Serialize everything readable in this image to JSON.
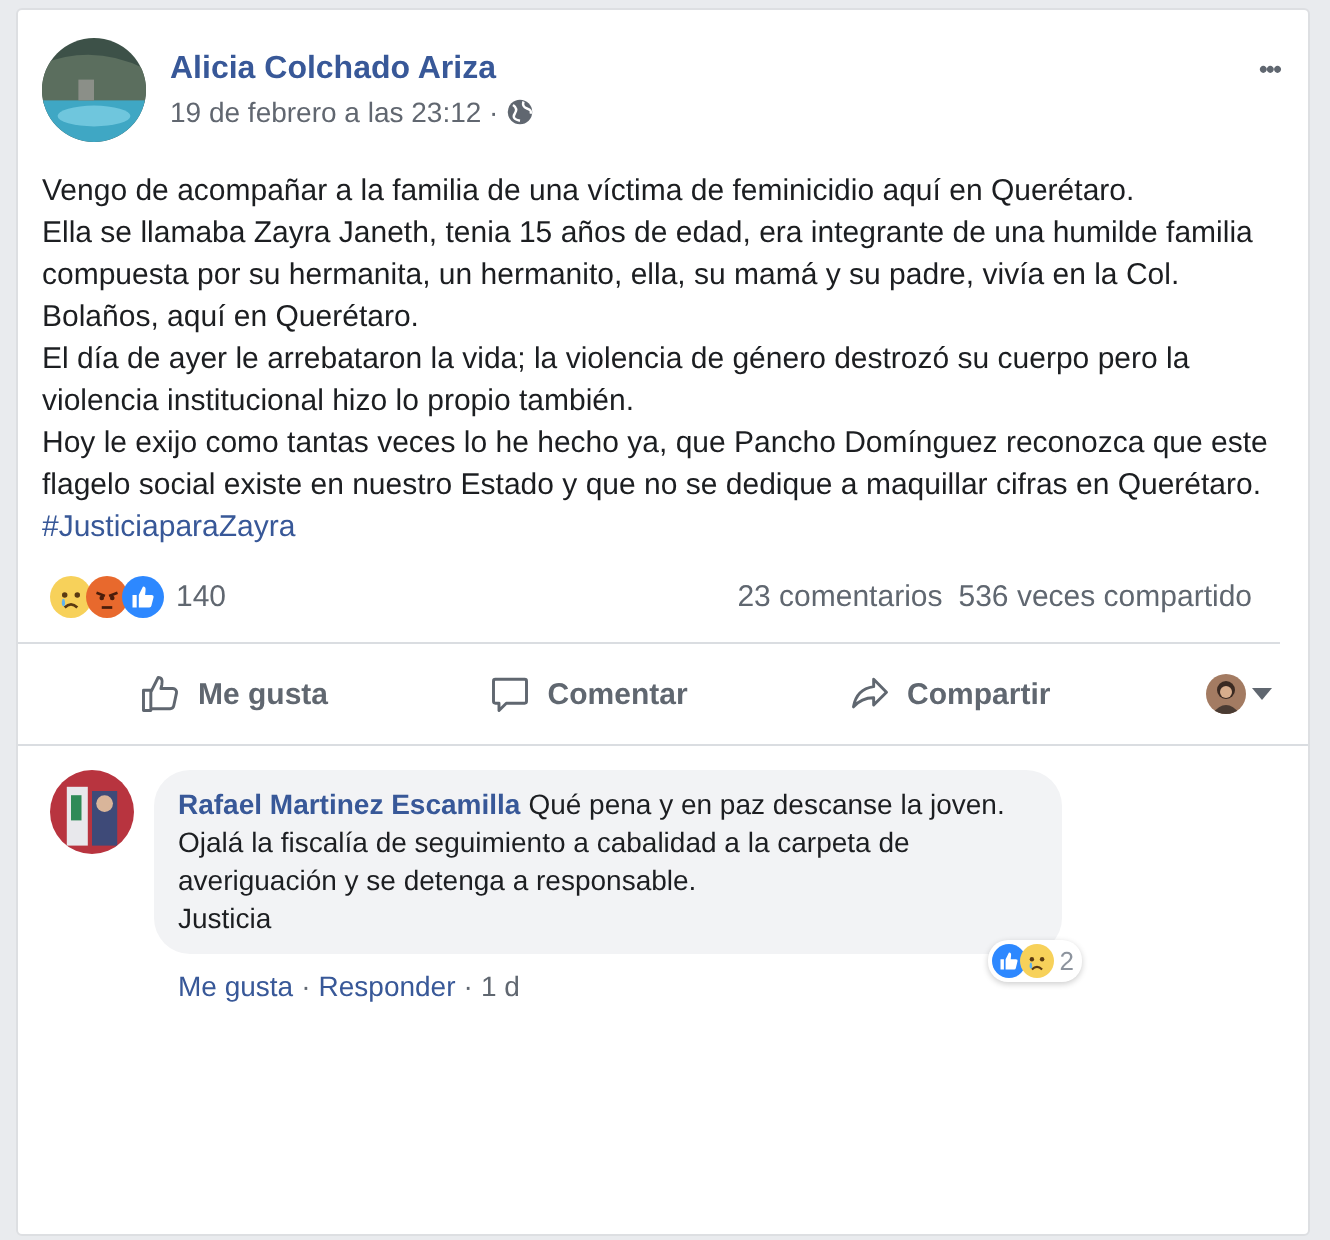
{
  "post": {
    "author": "Alicia Colchado Ariza",
    "time": "19 de febrero a las 23:12 ·",
    "more": "•••",
    "paragraphs": [
      "Vengo de acompañar a la familia de una víctima de feminicidio aquí en Querétaro.",
      "Ella se llamaba Zayra Janeth, tenia 15 años de edad, era integrante de una humilde familia compuesta por su hermanita, un hermanito, ella, su mamá y su padre, vivía en la Col. Bolaños, aquí en Querétaro.",
      "El día de ayer le arrebataron la vida; la violencia de género destrozó su cuerpo pero la violencia institucional hizo lo propio también.",
      "Hoy le exijo como tantas veces lo he hecho ya, que Pancho Domínguez reconozca que este flagelo social existe en nuestro Estado y que no se dedique a maquillar cifras en Querétaro."
    ],
    "hashtag": "#JusticiaparaZayra",
    "reactions": [
      {
        "kind": "sad"
      },
      {
        "kind": "angry"
      },
      {
        "kind": "like"
      }
    ],
    "reaction_count": "140",
    "comments_count": "23 comentarios",
    "shares_count": "536 veces compartido"
  },
  "actions": [
    {
      "kind": "like",
      "label": "Me gusta"
    },
    {
      "kind": "comment",
      "label": "Comentar"
    },
    {
      "kind": "share",
      "label": "Compartir"
    }
  ],
  "comment": {
    "author": "Rafael Martinez Escamilla",
    "text": "Qué pena y en paz descanse la joven.\nOjalá la fiscalía de seguimiento a cabalidad a la carpeta de averiguación y se detenga a responsable.\nJusticia",
    "reactions": [
      {
        "kind": "like"
      },
      {
        "kind": "sad"
      }
    ],
    "reaction_count": "2",
    "links": [
      "Me gusta",
      "Responder"
    ],
    "separator": "·",
    "age": "1 d"
  }
}
